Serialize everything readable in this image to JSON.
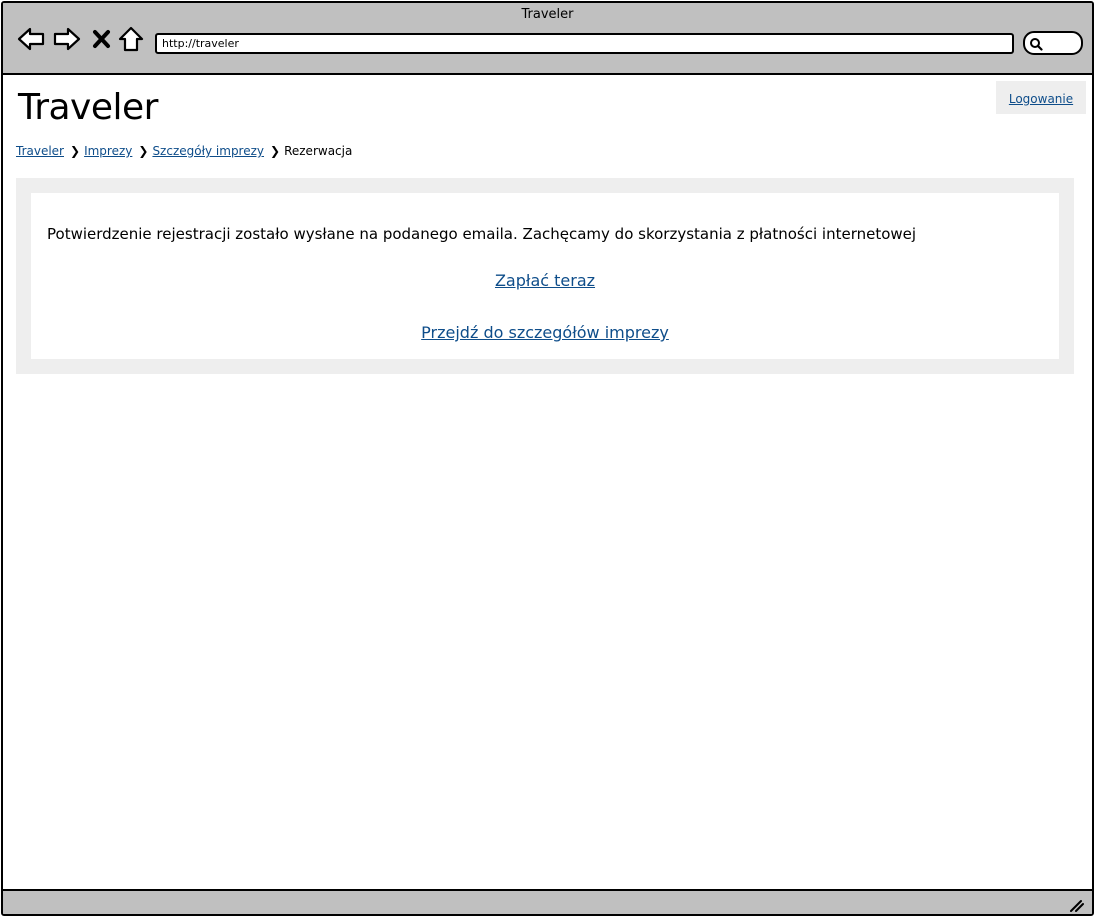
{
  "window": {
    "title": "Traveler"
  },
  "toolbar": {
    "back_icon": "back-arrow-icon",
    "forward_icon": "forward-arrow-icon",
    "stop_icon": "close-x-icon",
    "home_icon": "home-icon",
    "url": "http://traveler",
    "search_icon": "magnifier-icon"
  },
  "header": {
    "site_title": "Traveler",
    "login_label": "Logowanie"
  },
  "breadcrumb": {
    "items": [
      "Traveler",
      "Imprezy",
      "Szczegóły imprezy"
    ],
    "current": "Rezerwacja",
    "separator_icon": "chevron-right-icon"
  },
  "main": {
    "message": "Potwierdzenie rejestracji zostało wysłane na podanego emaila. Zachęcamy do skorzystania z płatności internetowej",
    "pay_link": "Zapłać teraz",
    "details_link": "Przejdź do szczegółów imprezy"
  },
  "colors": {
    "link": "#0e4d8a",
    "chrome": "#c0c0c0",
    "panel": "#eeeeee"
  }
}
